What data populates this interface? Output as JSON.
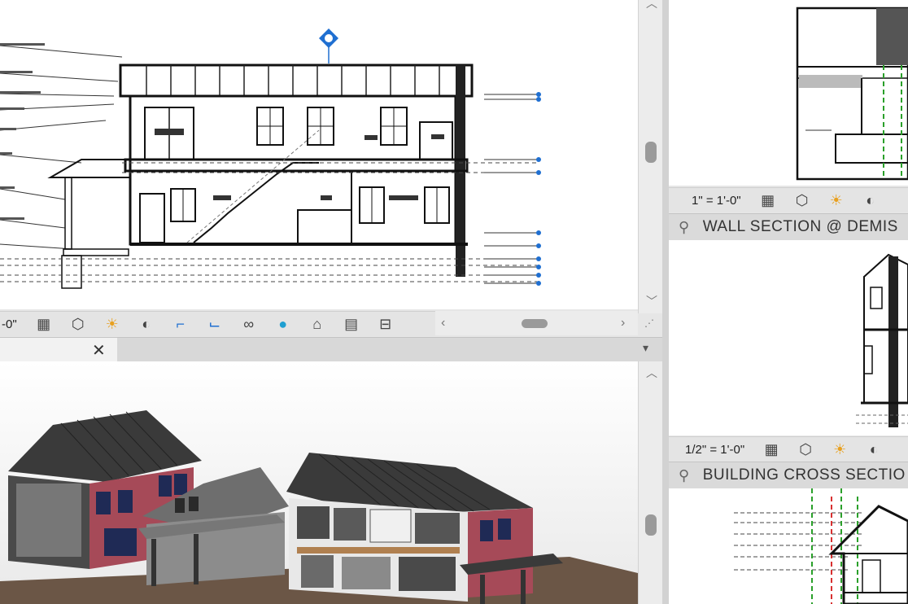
{
  "views": {
    "section_scale": "-0\"",
    "wall_section_scale": "1\" = 1'-0\"",
    "wall_demising_title": "WALL SECTION @ DEMIS",
    "wall_demising_scale": "1/2\" = 1'-0\"",
    "cross_section_title": "BUILDING CROSS SECTIO"
  },
  "icons": {
    "close": "✕"
  },
  "colors": {
    "panel_bg": "#ffffff",
    "bar_bg": "#e4e4e4",
    "header_bg": "#dadada",
    "accent_blue": "#1f6fd1",
    "marker_green": "#2aa02a",
    "marker_red": "#d83030"
  }
}
